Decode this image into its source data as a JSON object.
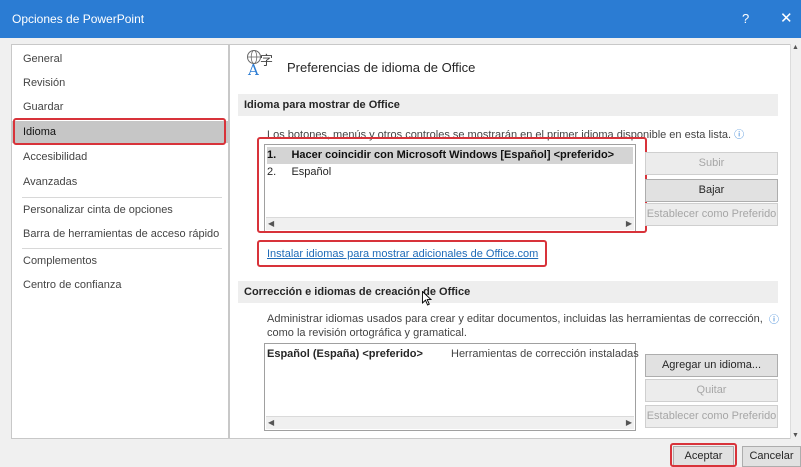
{
  "window": {
    "title": "Opciones de PowerPoint",
    "help": "?",
    "close": "✕"
  },
  "sidebar": {
    "items": [
      {
        "label": "General"
      },
      {
        "label": "Revisión"
      },
      {
        "label": "Guardar"
      },
      {
        "label": "Idioma"
      },
      {
        "label": "Accesibilidad"
      },
      {
        "label": "Avanzadas"
      },
      {
        "label": "Personalizar cinta de opciones"
      },
      {
        "label": "Barra de herramientas de acceso rápido"
      },
      {
        "label": "Complementos"
      },
      {
        "label": "Centro de confianza"
      }
    ],
    "selected": "Idioma"
  },
  "main": {
    "heading": "Preferencias de idioma de Office",
    "display": {
      "section_title": "Idioma para mostrar de Office",
      "description": "Los botones, menús y otros controles se mostrarán en el primer idioma disponible en esta lista.",
      "languages": [
        {
          "num": "1.",
          "name": "Hacer coincidir con Microsoft Windows [Español] <preferido>"
        },
        {
          "num": "2.",
          "name": "Español"
        }
      ],
      "buttons": {
        "up": "Subir",
        "down": "Bajar",
        "set_preferred": "Establecer como Preferido"
      },
      "install_link": "Instalar idiomas para mostrar adicionales de Office.com"
    },
    "authoring": {
      "section_title": "Corrección e idiomas de creación de Office",
      "description_1": "Administrar idiomas usados para crear y editar documentos, incluidas las herramientas de corrección,",
      "description_2": "como la revisión ortográfica y gramatical.",
      "languages": [
        {
          "name": "Español (España) <preferido>",
          "status": "Herramientas de corrección instaladas"
        }
      ],
      "buttons": {
        "add": "Agregar un idioma...",
        "remove": "Quitar",
        "set_preferred": "Establecer como Preferido"
      }
    }
  },
  "footer": {
    "ok": "Aceptar",
    "cancel": "Cancelar"
  },
  "colors": {
    "titlebar": "#2b7cd3",
    "highlight": "#d8333a",
    "link": "#1f6bb8"
  }
}
